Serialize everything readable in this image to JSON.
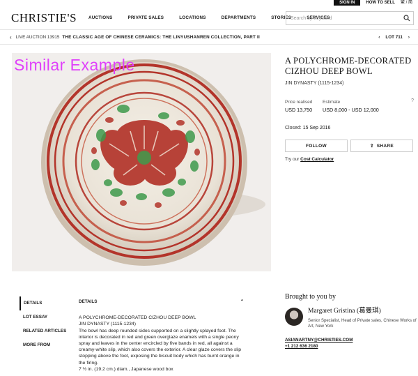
{
  "utility": {
    "sign_in": "SIGN IN",
    "how_to_sell": "HOW TO SELL",
    "language": "繁 / 简"
  },
  "header": {
    "logo": "CHRISTIE'S",
    "nav": [
      "AUCTIONS",
      "PRIVATE SALES",
      "LOCATIONS",
      "DEPARTMENTS",
      "STORIES",
      "SERVICES"
    ],
    "search_placeholder": "Search by keyword"
  },
  "breadcrumb": {
    "live": "LIVE AUCTION 13915",
    "title": "THE CLASSIC AGE OF CHINESE CERAMICS: THE LINYUSHANREN COLLECTION, PART II",
    "lot": "LOT 711"
  },
  "image": {
    "watermark": "Similar  Example"
  },
  "lot": {
    "title": "A POLYCHROME-DECORATED CIZHOU DEEP BOWL",
    "dynasty": "JIN DYNASTY (1115-1234)",
    "price_label": "Price realised",
    "price_value": "USD 13,750",
    "estimate_label": "Estimate",
    "estimate_value": "USD 8,000 - USD 12,000",
    "help": "?",
    "closed_label": "Closed:",
    "closed_date": "15 Sep 2016",
    "follow": "FOLLOW",
    "share": "SHARE",
    "calc_prefix": "Try our",
    "calc_link": "Cost Calculator"
  },
  "tabs": [
    "DETAILS",
    "LOT ESSAY",
    "RELATED ARTICLES",
    "MORE FROM"
  ],
  "details": {
    "heading": "DETAILS",
    "line1": "A POLYCHROME-DECORATED CIZHOU DEEP BOWL",
    "line2": "JIN DYNASTY (1115-1234)",
    "body": "The bowl has deep rounded sides supported on a slightly splayed foot. The interior is decorated in red and green overglaze enamels with a single peony spray and leaves in the center encircled by five bands in red, all against a creamy-white slip, which also covers the exterior. A clear glaze covers the slip stopping above the foot, exposing the biscuit body which has burnt orange in the firing.",
    "dims": "7 ½ in. (19.2 cm.) diam., Japanese wood box"
  },
  "brought": {
    "heading": "Brought to you by",
    "name": "Margaret Gristina (葛曼琪)",
    "role": "Senior Specialist, Head of Private sales, Chinese Works of Art, New York",
    "email": "ASIANARTNY@CHRISTIES.COM",
    "phone": "+1 212 636 2180"
  },
  "colors": {
    "watermark": "#e040fb",
    "bowl_red": "#b3342a",
    "bowl_green": "#3f9a4c",
    "image_bg": "#f1eeec"
  }
}
